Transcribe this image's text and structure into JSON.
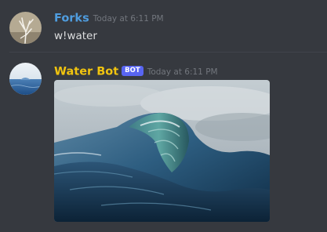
{
  "messages": [
    {
      "username": "Forks",
      "username_color": "#4f9ddf",
      "timestamp": "Today at 6:11 PM",
      "content": "w!water",
      "avatar_icon": "branches-avatar"
    },
    {
      "username": "Water Bot",
      "username_color": "#f1c40f",
      "bot_tag": "BOT",
      "timestamp": "Today at 6:11 PM",
      "avatar_icon": "ocean-avatar",
      "attachment": "wave-image"
    }
  ]
}
